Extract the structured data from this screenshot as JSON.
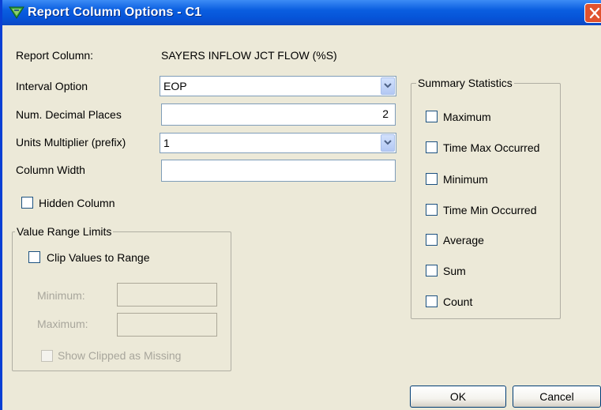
{
  "window": {
    "title": "Report Column Options - C1",
    "icon": "app-report-icon",
    "close_icon": "close-icon"
  },
  "report_column": {
    "label": "Report Column:",
    "value": "SAYERS INFLOW JCT FLOW (%S)"
  },
  "interval_option": {
    "label": "Interval Option",
    "value": "EOP"
  },
  "decimal_places": {
    "label": "Num. Decimal Places",
    "value": "2"
  },
  "units_multiplier": {
    "label": "Units Multiplier (prefix)",
    "value": "1"
  },
  "column_width": {
    "label": "Column Width",
    "value": ""
  },
  "hidden_column": {
    "label": "Hidden Column",
    "checked": false
  },
  "value_range": {
    "legend": "Value Range Limits",
    "clip_label": "Clip Values to Range",
    "clip_checked": false,
    "minimum_label": "Minimum:",
    "minimum_value": "",
    "maximum_label": "Maximum:",
    "maximum_value": "",
    "show_clipped_label": "Show Clipped as Missing",
    "show_clipped_checked": false
  },
  "summary": {
    "legend": "Summary Statistics",
    "items": [
      {
        "label": "Maximum",
        "checked": false
      },
      {
        "label": "Time Max Occurred",
        "checked": false
      },
      {
        "label": "Minimum",
        "checked": false
      },
      {
        "label": "Time Min Occurred",
        "checked": false
      },
      {
        "label": "Average",
        "checked": false
      },
      {
        "label": "Sum",
        "checked": false
      },
      {
        "label": "Count",
        "checked": false
      }
    ]
  },
  "buttons": {
    "ok": "OK",
    "cancel": "Cancel"
  },
  "colors": {
    "titlebar": "#0654d8",
    "dialog_bg": "#ece9d8",
    "close": "#e0522e",
    "input_border": "#7f9db9"
  }
}
